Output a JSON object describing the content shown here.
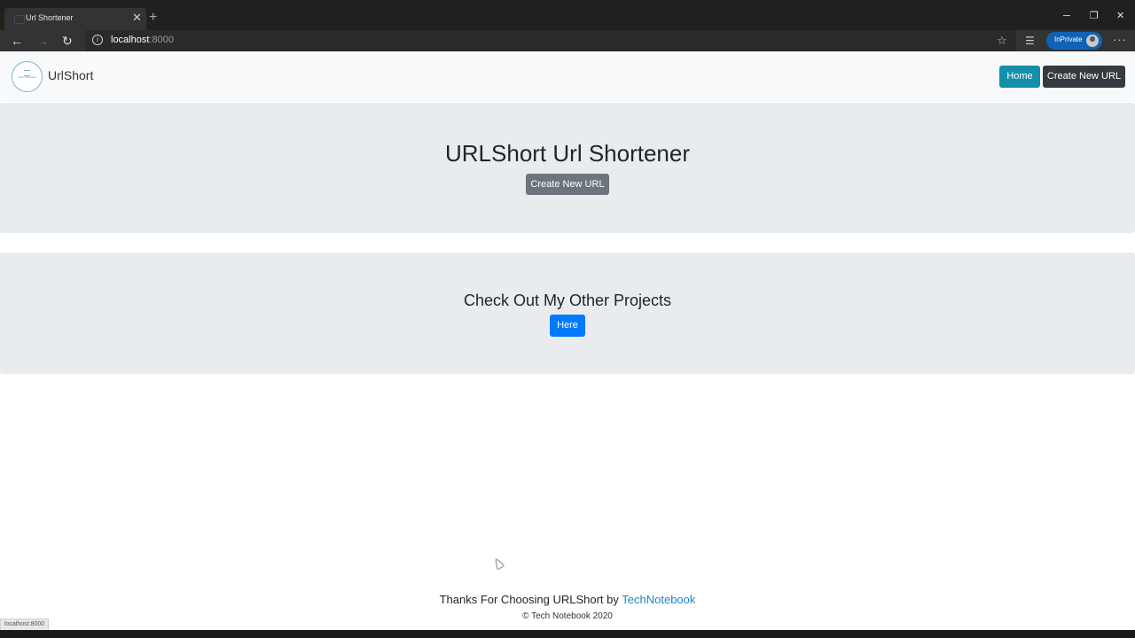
{
  "browser": {
    "tab": {
      "title": "Url Shortener"
    },
    "address": {
      "host": "localhost",
      "port": ":8000"
    },
    "inprivate_label": "InPrivate",
    "status_url": "localhost:8000"
  },
  "navbar": {
    "logo_text": "Tech Notebook",
    "brand": "UrlShort",
    "home_label": "Home",
    "create_label": "Create New URL",
    "colors": {
      "home": "#138faa",
      "create": "#343a40"
    }
  },
  "hero": {
    "title": "URLShort Url Shortener",
    "button_label": "Create New URL"
  },
  "projects": {
    "title": "Check Out My Other Projects",
    "button_label": "Here"
  },
  "footer": {
    "prefix": "Thanks For Choosing URLShort by",
    "link_label": "TechNotebook",
    "copyright": "© Tech Notebook 2020"
  },
  "icons": {
    "back": "←",
    "forward": "→",
    "reload": "↻",
    "star": "☆",
    "favorites": "☰",
    "more": "···",
    "close": "✕",
    "new_tab": "+",
    "minimize": "─",
    "restore": "❐"
  }
}
